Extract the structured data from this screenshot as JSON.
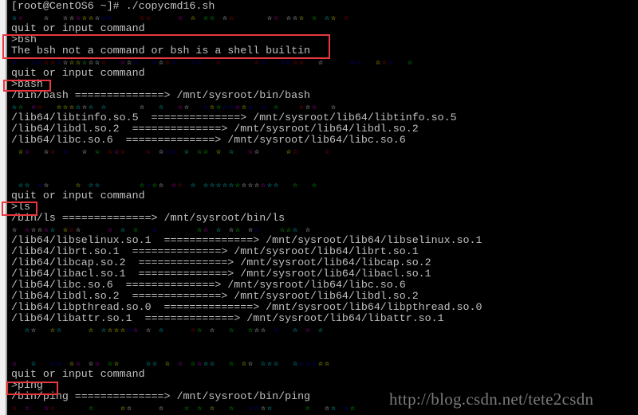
{
  "terminal": {
    "colors": {
      "c": "#00ffff",
      "m": "#ff00ff",
      "w": "#ffffff",
      "y": "#ffff00",
      "r": "#ff0000",
      "g": "#00ff00",
      "b": "#0000ff",
      "text": "#c0c0c0",
      "highlight_box": "#e8383d"
    },
    "lines": [
      {
        "type": "text",
        "text": "[root@CentOS6 ~]# ./copycmd16.sh"
      },
      {
        "type": "stars",
        "pattern": "cm   w  wwmyywbb    rr    m y gg wr     wm wwy g cy r"
      },
      {
        "type": "text",
        "text": "quit or input command"
      },
      {
        "type": "text",
        "text": ">bsh"
      },
      {
        "type": "text",
        "text": "The bsh not a command or bsh is a shell builtin"
      },
      {
        "type": "stars",
        "pattern": "b  bbrrbwyygwwr  mwb  bwrb  bb  r     rb  bbrr  w    bb  yrb  g"
      },
      {
        "type": "text",
        "text": "quit or input command"
      },
      {
        "type": "text",
        "text": ">bash"
      },
      {
        "type": "text",
        "text": "/bin/bash ==============> /mnt/sysroot/bin/bash"
      },
      {
        "type": "stars",
        "pattern": "cg mr  yyycwc c     w  c  mw  bygbbmyb b g   rwm  w"
      },
      {
        "type": "text",
        "text": "/lib64/libtinfo.so.5  ==============> /mnt/sysroot/lib64/libtinfo.so.5"
      },
      {
        "type": "text",
        "text": "/lib64/libdl.so.2  ==============> /mnt/sysroot/lib64/libdl.so.2"
      },
      {
        "type": "text",
        "text": "/lib64/libc.so.6  ==============> /mnt/sysroot/lib64/libc.so.6"
      },
      {
        "type": "stars",
        "pattern": " ym  wr b  w g rmr   r wbb c gg y c  mw    yr    r"
      },
      {
        "type": "text",
        "text": ""
      },
      {
        "type": "text",
        "text": ""
      },
      {
        "type": "stars",
        "pattern": " cc bw    y cc      gbgw mr c cccccgwwwmcc  g  g"
      },
      {
        "type": "text",
        "text": "quit or input command"
      },
      {
        "type": "text",
        "text": ">ls"
      },
      {
        "type": "text",
        "text": "/bin/ls ==============> /mnt/sysroot/bin/ls"
      },
      {
        "type": "stars",
        "pattern": "w mwwmc yrw    m c g  b      gm c wg wb   ggc w"
      },
      {
        "type": "text",
        "text": "/lib64/libselinux.so.1  ==============> /mnt/sysroot/lib64/libselinux.so.1"
      },
      {
        "type": "text",
        "text": "/lib64/librt.so.1  ==============> /mnt/sysroot/lib64/librt.so.1"
      },
      {
        "type": "text",
        "text": "/lib64/libcap.so.2  ==============> /mnt/sysroot/lib64/libcap.so.2"
      },
      {
        "type": "text",
        "text": "/lib64/libacl.so.1  ==============> /mnt/sysroot/lib64/libacl.so.1"
      },
      {
        "type": "text",
        "text": "/lib64/libc.so.6  ==============> /mnt/sysroot/lib64/libc.so.6"
      },
      {
        "type": "text",
        "text": "/lib64/libdl.so.2  ==============> /mnt/sysroot/lib64/libdl.so.2"
      },
      {
        "type": "text",
        "text": "/lib64/libpthread.so.0  ==============> /mnt/sysroot/lib64/libpthread.so.0"
      },
      {
        "type": "text",
        "text": "/lib64/libattr.so.1  ==============> /mnt/sysroot/lib64/libattr.so.1"
      },
      {
        "type": "stars",
        "pattern": "  cw  yc    y cyyybm w c    rg w  g  gww b  c m c"
      },
      {
        "type": "text",
        "text": ""
      },
      {
        "type": "text",
        "text": ""
      },
      {
        "type": "stars",
        "pattern": "m  c  bb ym wm gy    cc y m gmcc  g yw ccc  cbbbyy"
      },
      {
        "type": "text",
        "text": "quit or input command"
      },
      {
        "type": "text",
        "text": ">ping"
      },
      {
        "type": "text",
        "text": "/bin/ping ==============> /mnt/sysroot/bin/ping"
      },
      {
        "type": "stars",
        "pattern": "r m  mr     g    yw    w   g g y  g  bbwc     g  wc bg"
      }
    ]
  },
  "watermark": "http://blog.csdn.net/tete2csdn"
}
